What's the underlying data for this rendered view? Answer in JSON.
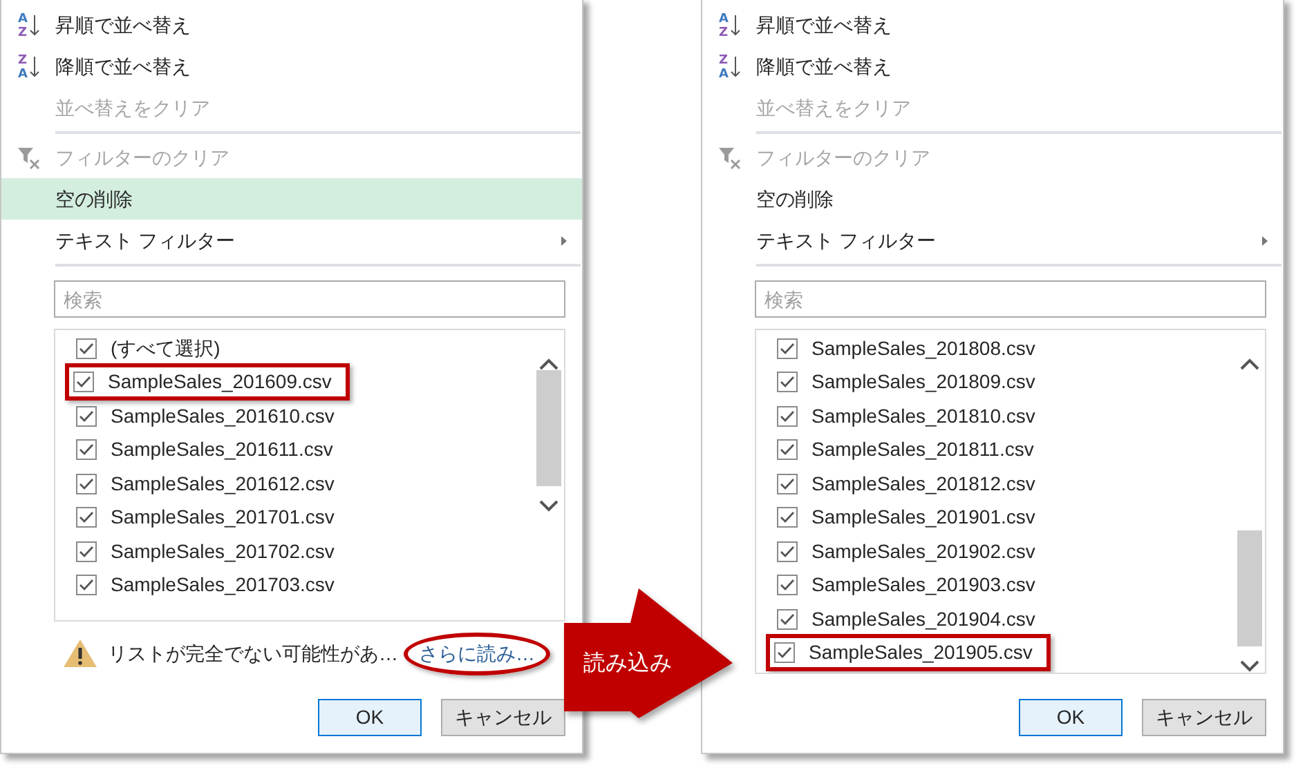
{
  "panels": [
    {
      "menu": [
        {
          "kind": "sort-asc",
          "icon_text": [
            "A",
            "Z"
          ],
          "label": "昇順で並べ替え",
          "disabled": false,
          "selected": false
        },
        {
          "kind": "sort-desc",
          "icon_text": [
            "Z",
            "A"
          ],
          "label": "降順で並べ替え",
          "disabled": false,
          "selected": false
        },
        {
          "kind": "plain",
          "label": "並べ替えをクリア",
          "disabled": true,
          "selected": false
        },
        {
          "kind": "separator"
        },
        {
          "kind": "filter-clear",
          "label": "フィルターのクリア",
          "disabled": true,
          "selected": false
        },
        {
          "kind": "plain",
          "label": "空の削除",
          "disabled": false,
          "selected": true
        },
        {
          "kind": "submenu",
          "label": "テキスト フィルター",
          "disabled": false,
          "selected": false
        },
        {
          "kind": "separator"
        }
      ],
      "search": {
        "placeholder": "検索"
      },
      "list": [
        {
          "label": "(すべて選択)",
          "checked": true,
          "highlighted": false
        },
        {
          "label": "SampleSales_201609.csv",
          "checked": true,
          "highlighted": true
        },
        {
          "label": "SampleSales_201610.csv",
          "checked": true,
          "highlighted": false
        },
        {
          "label": "SampleSales_201611.csv",
          "checked": true,
          "highlighted": false
        },
        {
          "label": "SampleSales_201612.csv",
          "checked": true,
          "highlighted": false
        },
        {
          "label": "SampleSales_201701.csv",
          "checked": true,
          "highlighted": false
        },
        {
          "label": "SampleSales_201702.csv",
          "checked": true,
          "highlighted": false
        },
        {
          "label": "SampleSales_201703.csv",
          "checked": true,
          "highlighted": false
        }
      ],
      "scrolled_to_end": false,
      "warning": {
        "text": "リストが完全でない可能性があ…",
        "link": "さらに読み…",
        "circled": true
      },
      "buttons": [
        "OK",
        "キャンセル"
      ]
    },
    {
      "menu": [
        {
          "kind": "sort-asc",
          "icon_text": [
            "A",
            "Z"
          ],
          "label": "昇順で並べ替え",
          "disabled": false,
          "selected": false
        },
        {
          "kind": "sort-desc",
          "icon_text": [
            "Z",
            "A"
          ],
          "label": "降順で並べ替え",
          "disabled": false,
          "selected": false
        },
        {
          "kind": "plain",
          "label": "並べ替えをクリア",
          "disabled": true,
          "selected": false
        },
        {
          "kind": "separator"
        },
        {
          "kind": "filter-clear",
          "label": "フィルターのクリア",
          "disabled": true,
          "selected": false
        },
        {
          "kind": "plain",
          "label": "空の削除",
          "disabled": false,
          "selected": false
        },
        {
          "kind": "submenu",
          "label": "テキスト フィルター",
          "disabled": false,
          "selected": false
        },
        {
          "kind": "separator"
        }
      ],
      "search": {
        "placeholder": "検索"
      },
      "list": [
        {
          "label": "SampleSales_201808.csv",
          "checked": true,
          "highlighted": false
        },
        {
          "label": "SampleSales_201809.csv",
          "checked": true,
          "highlighted": false
        },
        {
          "label": "SampleSales_201810.csv",
          "checked": true,
          "highlighted": false
        },
        {
          "label": "SampleSales_201811.csv",
          "checked": true,
          "highlighted": false
        },
        {
          "label": "SampleSales_201812.csv",
          "checked": true,
          "highlighted": false
        },
        {
          "label": "SampleSales_201901.csv",
          "checked": true,
          "highlighted": false
        },
        {
          "label": "SampleSales_201902.csv",
          "checked": true,
          "highlighted": false
        },
        {
          "label": "SampleSales_201903.csv",
          "checked": true,
          "highlighted": false
        },
        {
          "label": "SampleSales_201904.csv",
          "checked": true,
          "highlighted": false
        },
        {
          "label": "SampleSales_201905.csv",
          "checked": true,
          "highlighted": true
        }
      ],
      "scrolled_to_end": true,
      "buttons": [
        "OK",
        "キャンセル"
      ]
    }
  ],
  "arrow": {
    "label": "読み込み"
  }
}
